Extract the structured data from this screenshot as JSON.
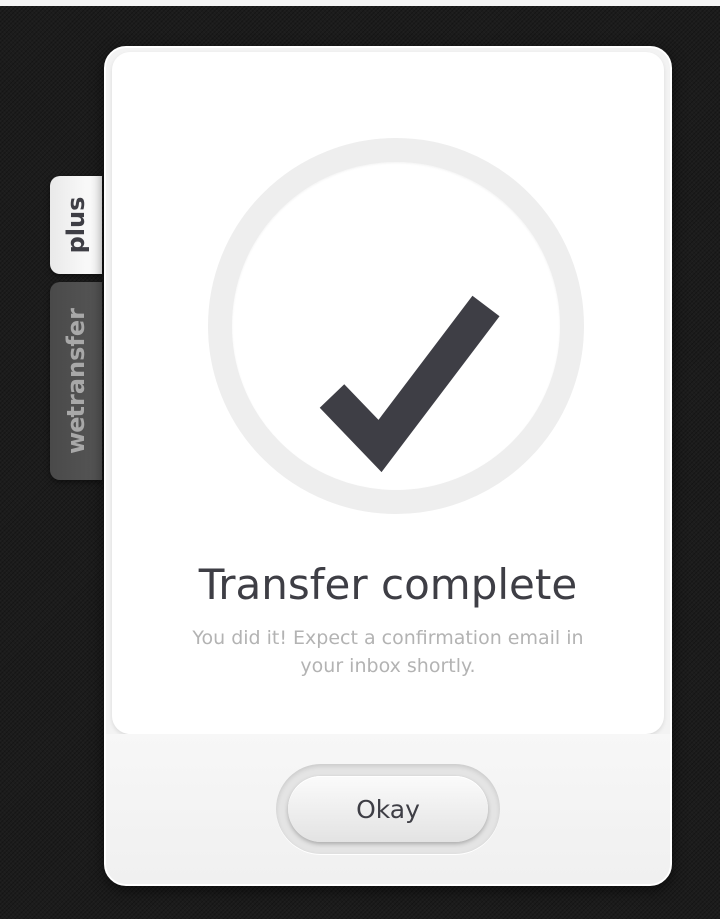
{
  "tabs": {
    "plus_label": "plus",
    "brand_prefix": "we",
    "brand_suffix": "transfer"
  },
  "dialog": {
    "icon": "checkmark-icon",
    "title": "Transfer complete",
    "message_line1": "You did it! Expect a confirmation email in",
    "message_line2": "your inbox shortly.",
    "button_label": "Okay"
  },
  "colors": {
    "dark_text": "#3e3e45",
    "muted_text": "#b3b3b3",
    "background": "#1c1c1c"
  }
}
